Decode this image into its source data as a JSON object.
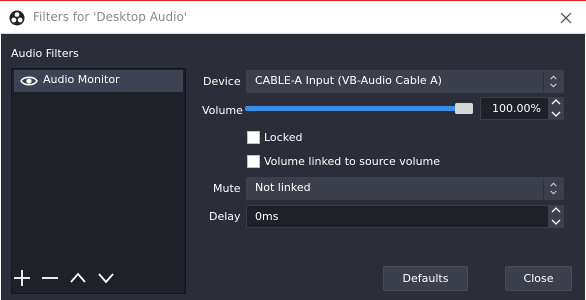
{
  "window": {
    "title": "Filters for 'Desktop Audio'",
    "app_icon": "obs-logo-icon",
    "close_icon": "close-icon"
  },
  "colors": {
    "panel_bg": "#2b2e38",
    "list_bg": "#1f2128",
    "selection": "#3d4352",
    "accent": "#3a8ee6",
    "control_bg": "#3c404c"
  },
  "filters": {
    "section_label": "Audio Filters",
    "items": [
      {
        "name": "Audio Monitor",
        "icon": "eye-icon",
        "selected": true
      }
    ]
  },
  "properties": {
    "device": {
      "label": "Device",
      "value": "CABLE-A Input (VB-Audio Cable A)"
    },
    "volume": {
      "label": "Volume",
      "value": "100.00%",
      "level_fraction": 1.0
    },
    "locked": {
      "label": "Locked",
      "checked": false
    },
    "volume_linked": {
      "label": "Volume linked to source volume",
      "checked": false
    },
    "mute": {
      "label": "Mute",
      "value": "Not linked"
    },
    "delay": {
      "label": "Delay",
      "value": "0ms"
    }
  },
  "toolbar": {
    "add_icon": "plus-icon",
    "remove_icon": "minus-icon",
    "move_up_icon": "chevron-up-icon",
    "move_down_icon": "chevron-down-icon"
  },
  "buttons": {
    "defaults_label": "Defaults",
    "close_label": "Close"
  }
}
